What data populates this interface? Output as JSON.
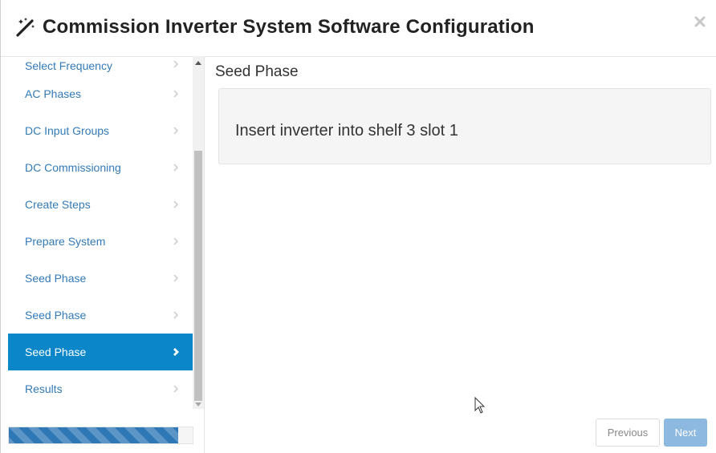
{
  "dialog": {
    "title": "Commission Inverter System Software Configuration",
    "title_icon": "magic-wand-icon",
    "close_icon": "close-icon"
  },
  "sidebar": {
    "items": [
      {
        "label": "Select Frequency",
        "active": false
      },
      {
        "label": "AC Phases",
        "active": false
      },
      {
        "label": "DC Input Groups",
        "active": false
      },
      {
        "label": "DC Commissioning",
        "active": false
      },
      {
        "label": "Create Steps",
        "active": false
      },
      {
        "label": "Prepare System",
        "active": false
      },
      {
        "label": "Seed Phase",
        "active": false
      },
      {
        "label": "Seed Phase",
        "active": false
      },
      {
        "label": "Seed Phase",
        "active": true
      },
      {
        "label": "Results",
        "active": false
      }
    ],
    "progress_fraction": 0.92
  },
  "main": {
    "section_title": "Seed Phase",
    "instruction": "Insert inverter into shelf 3 slot 1"
  },
  "footer": {
    "previous_label": "Previous",
    "next_label": "Next"
  },
  "colors": {
    "active_item": "#0a86c9",
    "link": "#337ab7",
    "next_button": "#8db8e0",
    "progress": "#2f78b6"
  }
}
